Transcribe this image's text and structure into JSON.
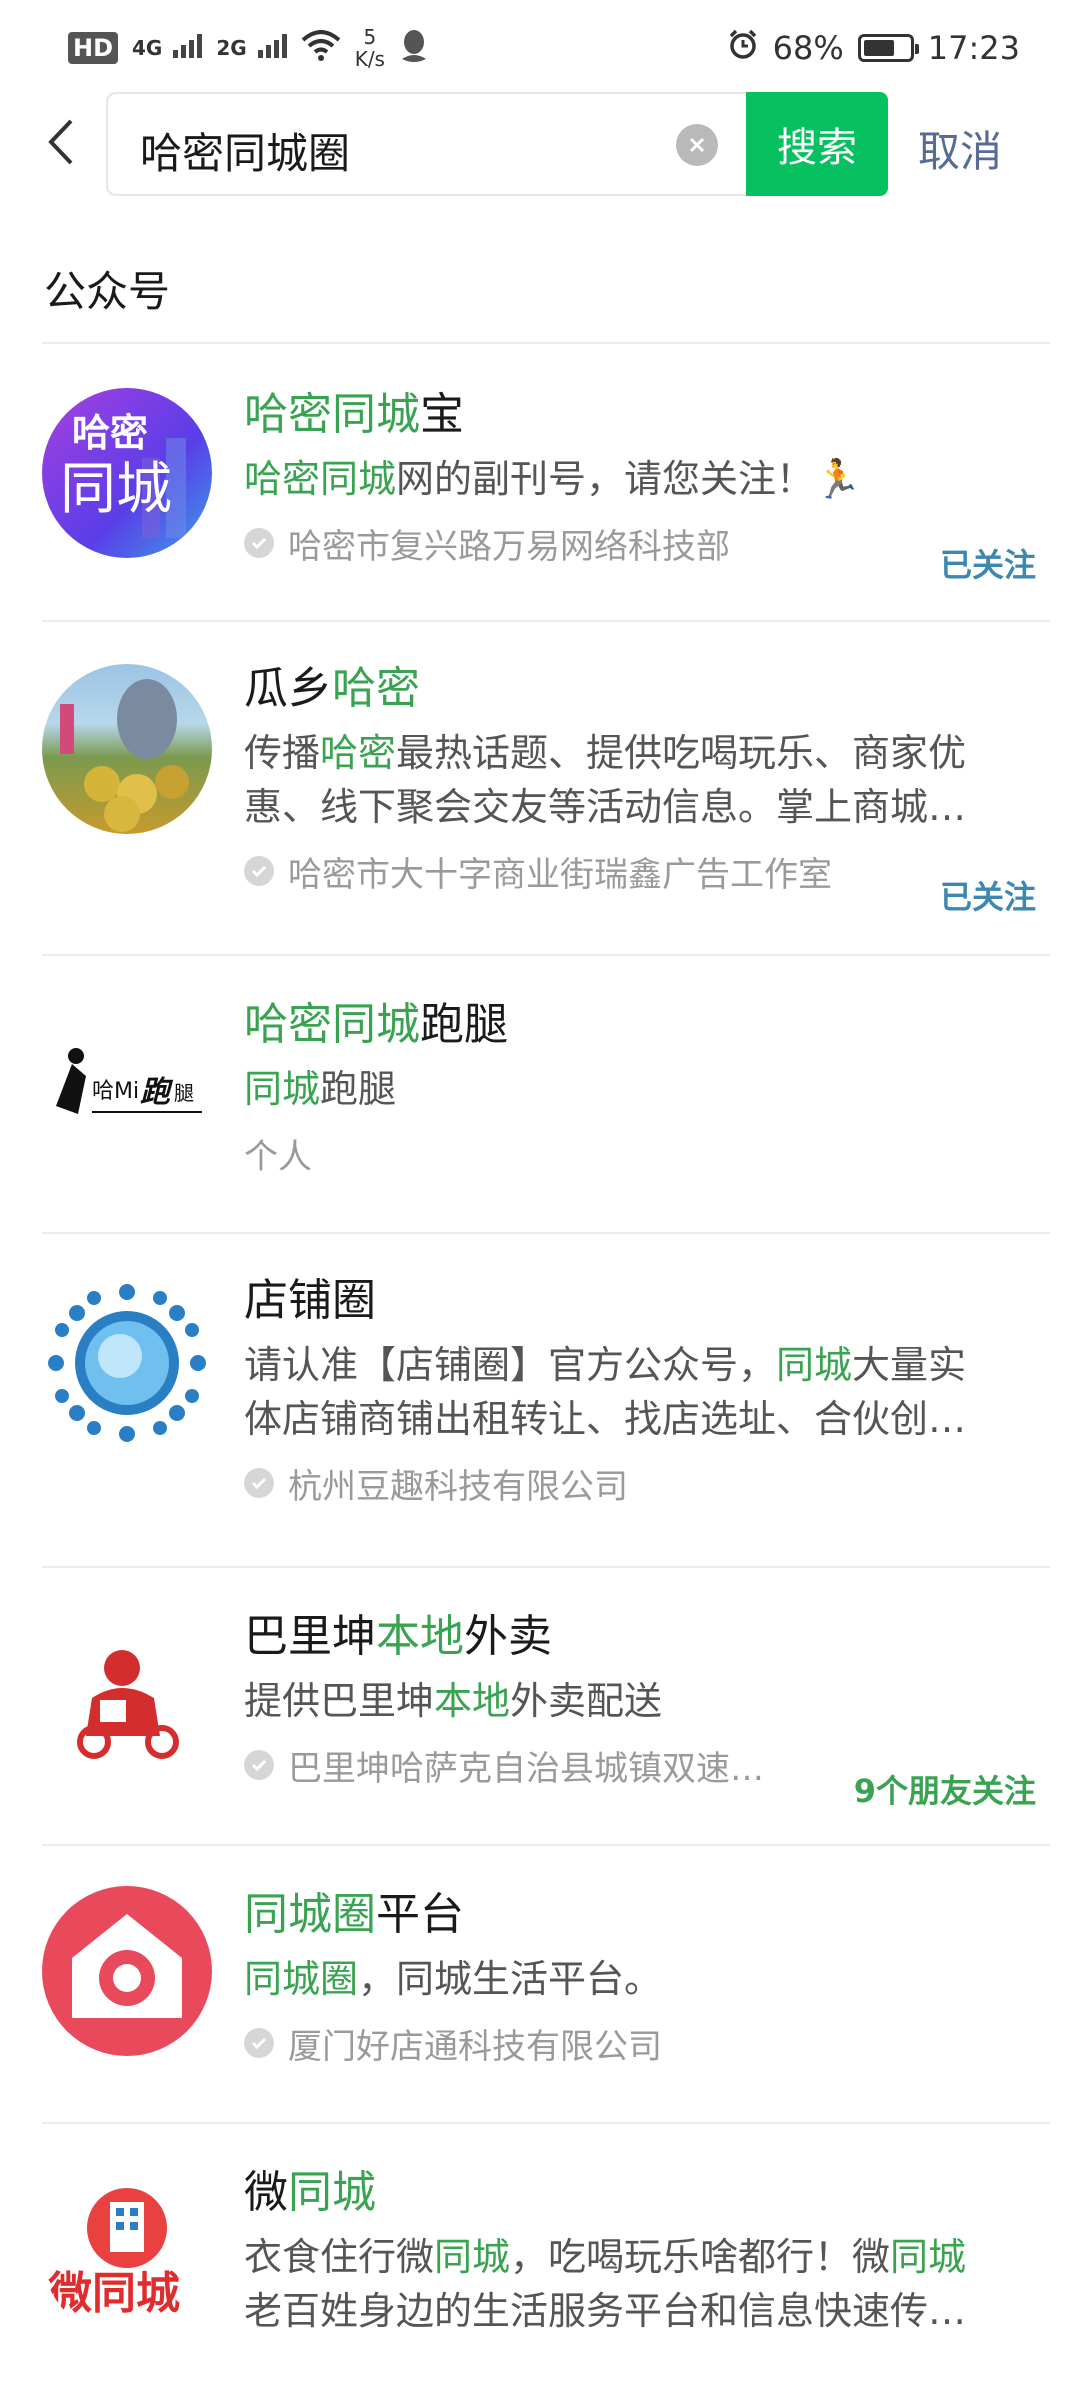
{
  "status_bar": {
    "hd": "HD",
    "net1": "4G",
    "net2": "2G",
    "speed_value": "5",
    "speed_unit": "K/s",
    "battery": "68%",
    "battery_level": 0.68,
    "time": "17:23"
  },
  "search": {
    "query": "哈密同城圈",
    "button_label": "搜索",
    "cancel_label": "取消"
  },
  "section_title": "公众号",
  "colors": {
    "accent": "#07c160",
    "highlight": "#3aa351",
    "link": "#576b95",
    "followed": "#3c88b0"
  },
  "results": [
    {
      "name_parts": [
        {
          "t": "哈密同城",
          "hl": true
        },
        {
          "t": "宝",
          "hl": false
        }
      ],
      "desc_lines": [
        [
          {
            "t": "哈密同城",
            "hl": true
          },
          {
            "t": "网的副刊号，请您关注！🏃",
            "hl": false
          }
        ]
      ],
      "meta": "哈密市复兴路万易网络科技部",
      "follow": "已关注",
      "avatar_text": "哈密同城"
    },
    {
      "name_parts": [
        {
          "t": "瓜乡",
          "hl": false
        },
        {
          "t": "哈密",
          "hl": true
        }
      ],
      "desc_lines": [
        [
          {
            "t": "传播",
            "hl": false
          },
          {
            "t": "哈密",
            "hl": true
          },
          {
            "t": "最热话题、提供吃喝玩乐、商家优",
            "hl": false
          }
        ],
        [
          {
            "t": "惠、线下聚会交友等活动信息。掌上商城…",
            "hl": false
          }
        ]
      ],
      "meta": "哈密市大十字商业街瑞鑫广告工作室",
      "follow": "已关注"
    },
    {
      "name_parts": [
        {
          "t": "哈密同城",
          "hl": true
        },
        {
          "t": "跑腿",
          "hl": false
        }
      ],
      "desc_lines": [
        [
          {
            "t": "同城",
            "hl": true
          },
          {
            "t": "跑腿",
            "hl": false
          }
        ]
      ],
      "meta": "个人",
      "follow": "",
      "avatar_text": "哈Mi跑腿"
    },
    {
      "name_parts": [
        {
          "t": "店铺圈",
          "hl": false
        }
      ],
      "desc_lines": [
        [
          {
            "t": "请认准【店铺圈】官方公众号，",
            "hl": false
          },
          {
            "t": "同城",
            "hl": true
          },
          {
            "t": "大量实",
            "hl": false
          }
        ],
        [
          {
            "t": "体店铺商铺出租转让、找店选址、合伙创…",
            "hl": false
          }
        ]
      ],
      "meta": "杭州豆趣科技有限公司",
      "follow": ""
    },
    {
      "name_parts": [
        {
          "t": "巴里坤",
          "hl": false
        },
        {
          "t": "本地",
          "hl": true
        },
        {
          "t": "外卖",
          "hl": false
        }
      ],
      "desc_lines": [
        [
          {
            "t": "提供巴里坤",
            "hl": false
          },
          {
            "t": "本地",
            "hl": true
          },
          {
            "t": "外卖配送",
            "hl": false
          }
        ]
      ],
      "meta": "巴里坤哈萨克自治县城镇双速…",
      "follow": "9个朋友关注"
    },
    {
      "name_parts": [
        {
          "t": "同城圈",
          "hl": true
        },
        {
          "t": "平台",
          "hl": false
        }
      ],
      "desc_lines": [
        [
          {
            "t": "同城圈",
            "hl": true
          },
          {
            "t": "，同城生活平台。",
            "hl": false
          }
        ]
      ],
      "meta": "厦门好店通科技有限公司",
      "follow": ""
    },
    {
      "name_parts": [
        {
          "t": "微",
          "hl": false
        },
        {
          "t": "同城",
          "hl": true
        }
      ],
      "desc_lines": [
        [
          {
            "t": "衣食住行微",
            "hl": false
          },
          {
            "t": "同城",
            "hl": true
          },
          {
            "t": "，吃喝玩乐啥都行！微",
            "hl": false
          },
          {
            "t": "同城",
            "hl": true
          }
        ],
        [
          {
            "t": "老百姓身边的生活服务平台和信息快速传…",
            "hl": false
          }
        ]
      ],
      "meta": "",
      "follow": "",
      "avatar_text": "微同城"
    }
  ]
}
